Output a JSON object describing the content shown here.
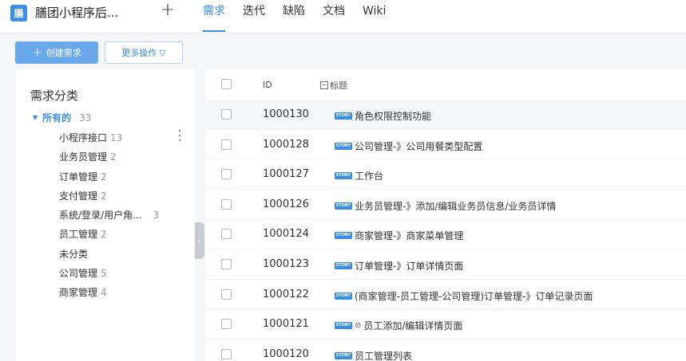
{
  "header": {
    "logo_char": "膳",
    "project_title": "膳团小程序后...",
    "add_symbol": "+",
    "nav": [
      {
        "label": "需求",
        "active": true
      },
      {
        "label": "迭代",
        "active": false
      },
      {
        "label": "缺陷",
        "active": false
      },
      {
        "label": "文档",
        "active": false
      },
      {
        "label": "Wiki",
        "active": false
      }
    ]
  },
  "toolbar": {
    "create_label": "创建需求",
    "more_label": "更多操作",
    "more_caret": "▽"
  },
  "sidebar": {
    "title": "需求分类",
    "all_label": "所有的",
    "all_count": "33",
    "categories": [
      {
        "label": "小程序接口",
        "count": "13"
      },
      {
        "label": "业务员管理",
        "count": "2"
      },
      {
        "label": "订单管理",
        "count": "2"
      },
      {
        "label": "支付管理",
        "count": "2"
      },
      {
        "label": "系统/登录/用户角...",
        "count": "3"
      },
      {
        "label": "员工管理",
        "count": "2"
      },
      {
        "label": "未分类",
        "count": ""
      },
      {
        "label": "公司管理",
        "count": "5"
      },
      {
        "label": "商家管理",
        "count": "4"
      }
    ]
  },
  "table": {
    "col_id": "ID",
    "col_title": "标题",
    "badge": "STORY",
    "rows": [
      {
        "id": "1000130",
        "title": "角色权限控制功能",
        "attach": false
      },
      {
        "id": "1000128",
        "title": "公司管理-》公司用餐类型配置",
        "attach": false
      },
      {
        "id": "1000127",
        "title": "工作台",
        "attach": false
      },
      {
        "id": "1000126",
        "title": "业务员管理-》添加/编辑业务员信息/业务员详情",
        "attach": false
      },
      {
        "id": "1000124",
        "title": "商家管理-》商家菜单管理",
        "attach": false
      },
      {
        "id": "1000123",
        "title": "订单管理-》订单详情页面",
        "attach": false
      },
      {
        "id": "1000122",
        "title": "(商家管理-员工管理-公司管理)订单管理-》订单记录页面",
        "attach": false
      },
      {
        "id": "1000121",
        "title": "员工添加/编辑详情页面",
        "attach": true
      },
      {
        "id": "1000120",
        "title": "员工管理列表",
        "attach": false
      }
    ]
  },
  "colors": {
    "accent": "#3a8ee6",
    "create_button_bg": "#69a8ea",
    "page_bg": "#f5f6f8"
  }
}
